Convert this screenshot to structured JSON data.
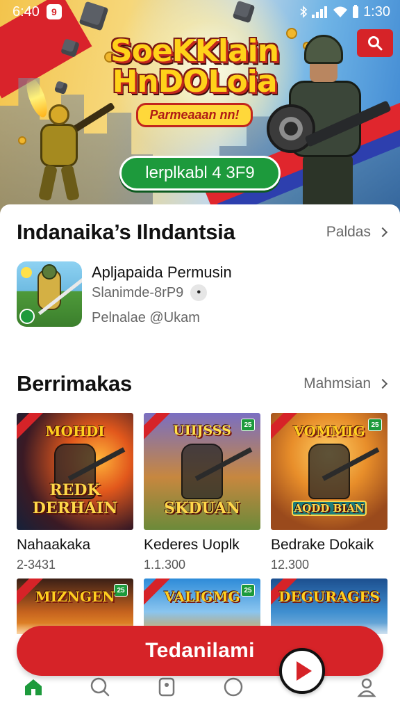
{
  "status_bar": {
    "time": "6:40",
    "notification_glyph": "9",
    "clock_right": "1:30"
  },
  "hero": {
    "title_line1": "SoeKKlain",
    "title_line2": "HnDOLoia",
    "ribbon": "Parmeaaan nn!",
    "cta": "lerplkabl 4 3F9"
  },
  "featured": {
    "heading": "Indanaika’s Ilndantsia",
    "link": "Paldas",
    "app_name": "Apljapaida Permusin",
    "app_subtitle": "Slanimde-8rP9",
    "info_glyph": "•",
    "app_developer": "Pelnalae @Ukam"
  },
  "section2": {
    "heading": "Berrimakas",
    "link": "Mahmsian"
  },
  "games": [
    {
      "art_top": "MOHDI",
      "art_bottom": "REDK DERHAIN",
      "badge": "",
      "name": "Nahaakaka",
      "meta": "2-3431"
    },
    {
      "art_top": "UIIJSSS",
      "art_bottom": "SKDUAN",
      "badge": "25",
      "name": "Kederes Uoplk",
      "meta": "1.1.300"
    },
    {
      "art_top": "VOMMIG",
      "art_bottom": "AQDD BIAN",
      "badge": "25",
      "name": "Bedrake Dokaik",
      "meta": "12.300"
    }
  ],
  "games_row2": [
    {
      "art_top": "MIZNGEN",
      "badge": "25"
    },
    {
      "art_top": "VALIGMG",
      "badge": "25"
    },
    {
      "art_top": "DEGURAGES",
      "badge": ""
    }
  ],
  "install_button": "Tedanilami",
  "colors": {
    "brand_red": "#d62328",
    "accent_green": "#1d9a3c",
    "text_primary": "#111111",
    "text_secondary": "#666666"
  },
  "icons": {
    "search": "search-icon",
    "home": "home-icon",
    "explore": "magnifier-icon",
    "tag": "tag-icon",
    "circle": "circle-icon",
    "profile": "person-icon",
    "play": "play-icon"
  }
}
